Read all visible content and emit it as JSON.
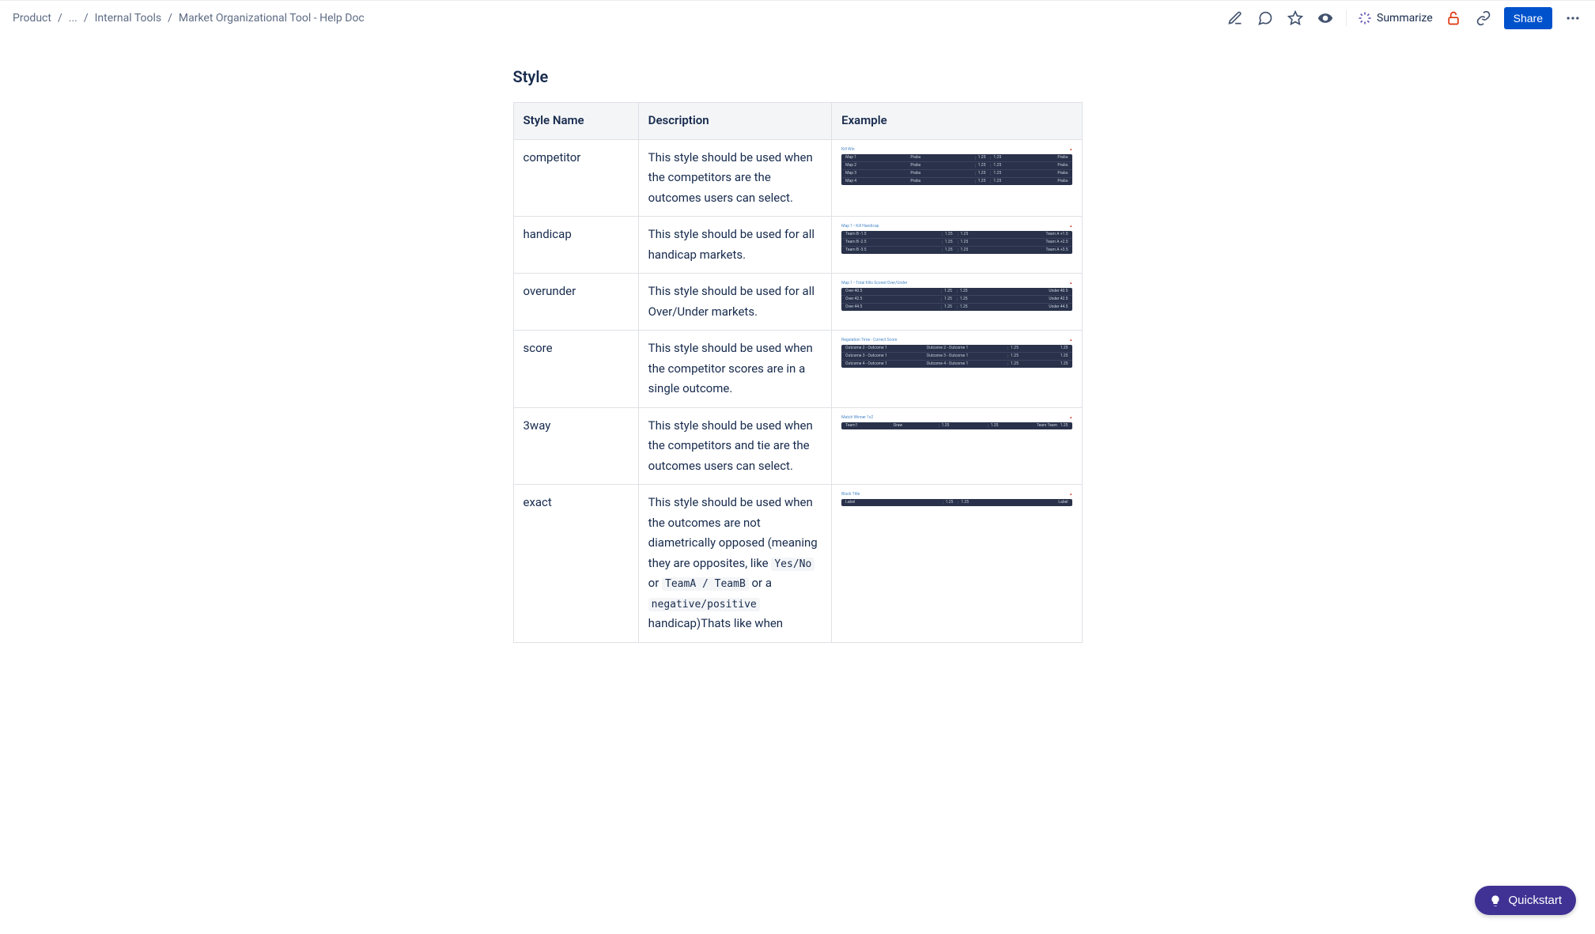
{
  "breadcrumbs": {
    "items": [
      "Product",
      "...",
      "Internal Tools",
      "Market Organizational Tool - Help Doc"
    ]
  },
  "actions": {
    "summarize": "Summarize",
    "share": "Share"
  },
  "section_title": "Style",
  "table": {
    "headers": [
      "Style Name",
      "Description",
      "Example"
    ],
    "rows": [
      {
        "name": "competitor",
        "desc": "This style should be used when the competitors are the outcomes users can select.",
        "example": {
          "title": "Kill Win",
          "rows": [
            {
              "l": "Map 1",
              "m": "Prabu",
              "nums": [
                "1.25",
                "1.25"
              ],
              "r": "Prabu"
            },
            {
              "l": "Map 2",
              "m": "Prabu",
              "nums": [
                "1.25",
                "1.25"
              ],
              "r": "Prabu"
            },
            {
              "l": "Map 3",
              "m": "Prabu",
              "nums": [
                "1.25",
                "1.25"
              ],
              "r": "Prabu"
            },
            {
              "l": "Map 4",
              "m": "Prabu",
              "nums": [
                "1.25",
                "1.25"
              ],
              "r": "Prabu"
            }
          ]
        }
      },
      {
        "name": "handicap",
        "desc": "This style should be used for all handicap markets.",
        "example": {
          "title": "Map 1 • Kill Handicap",
          "rows": [
            {
              "l": "Team B -1.5",
              "nums": [
                "1.25",
                "1.25"
              ],
              "r": "Team A +1.5"
            },
            {
              "l": "Team B -2.5",
              "nums": [
                "1.25",
                "1.25"
              ],
              "r": "Team A +2.5"
            },
            {
              "l": "Team B -3.5",
              "nums": [
                "1.25",
                "1.25"
              ],
              "r": "Team A +3.5"
            }
          ]
        }
      },
      {
        "name": "overunder",
        "desc": "This style should be used for all Over/Under markets.",
        "example": {
          "title": "Map 1 • Total Kills Scored Over/Under",
          "rows": [
            {
              "l": "Over 40.5",
              "nums": [
                "1.25",
                "1.25"
              ],
              "r": "Under 40.5"
            },
            {
              "l": "Over 42.5",
              "nums": [
                "1.25",
                "1.25"
              ],
              "r": "Under 42.5"
            },
            {
              "l": "Over 44.5",
              "nums": [
                "1.25",
                "1.25"
              ],
              "r": "Under 44.5"
            }
          ]
        }
      },
      {
        "name": "score",
        "desc": "This style should be used when the competitor scores are in a single outcome.",
        "example": {
          "title": "Regulation Time - Correct Score",
          "rows": [
            {
              "l": "Outcome 2 - Outcome 1",
              "nums": [
                "1.25"
              ],
              "m": "Outcome 2 - Outcome 1",
              "r": "1.25"
            },
            {
              "l": "Outcome 3 - Outcome 1",
              "nums": [
                "1.25"
              ],
              "m": "Outcome 3 - Outcome 1",
              "r": "1.25"
            },
            {
              "l": "Outcome 4 - Outcome 1",
              "nums": [
                "1.25"
              ],
              "m": "Outcome 4 - Outcome 1",
              "r": "1.25"
            }
          ]
        }
      },
      {
        "name": "3way",
        "desc": "This style should be used when the competitors and tie are the outcomes users can select.",
        "example": {
          "title": "Match Winner 1x2",
          "rows": [
            {
              "l": "Team1",
              "nums": [
                "1.25"
              ],
              "m": "Draw",
              "nums2": [
                "1.25"
              ],
              "r": "Team Team",
              "r2": "1.25"
            }
          ]
        }
      },
      {
        "name": "exact",
        "desc_parts": [
          {
            "t": "This style should be used when the outcomes are not diametrically opposed (meaning they are opposites, like "
          },
          {
            "code": "Yes/No"
          },
          {
            "t": " or "
          },
          {
            "code": "TeamA / TeamB"
          },
          {
            "t": " or a "
          },
          {
            "code": "negative/positive"
          },
          {
            "t": " handicap)Thats like when"
          }
        ],
        "example": {
          "title": "Block Title",
          "rows": [
            {
              "l": "Label",
              "nums": [
                "1.25",
                "1.25"
              ],
              "r": "Label"
            }
          ]
        }
      }
    ]
  },
  "quickstart": "Quickstart"
}
